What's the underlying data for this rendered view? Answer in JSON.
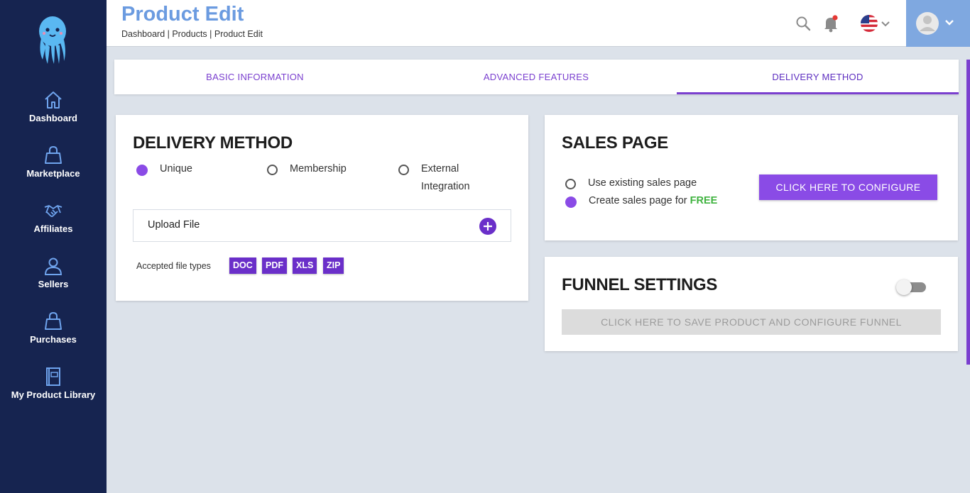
{
  "sidebar": {
    "items": [
      {
        "label": "Dashboard",
        "icon": "home-icon"
      },
      {
        "label": "Marketplace",
        "icon": "shopping-bag-icon"
      },
      {
        "label": "Affiliates",
        "icon": "handshake-icon"
      },
      {
        "label": "Sellers",
        "icon": "users-icon"
      },
      {
        "label": "Purchases",
        "icon": "shopping-bag-icon"
      },
      {
        "label": "My Product Library",
        "icon": "book-icon"
      }
    ]
  },
  "header": {
    "title": "Product Edit",
    "breadcrumb": "Dashboard | Products | Product Edit"
  },
  "tabs": [
    {
      "label": "BASIC INFORMATION",
      "active": false
    },
    {
      "label": "ADVANCED FEATURES",
      "active": false
    },
    {
      "label": "DELIVERY METHOD",
      "active": true
    }
  ],
  "delivery": {
    "title": "DELIVERY METHOD",
    "options": [
      {
        "label": "Unique",
        "checked": true
      },
      {
        "label": "Membership",
        "checked": false
      },
      {
        "label": "External Integration",
        "checked": false
      }
    ],
    "upload_label": "Upload File",
    "accepted_label": "Accepted file types",
    "file_types": [
      "DOC",
      "PDF",
      "XLS",
      "ZIP"
    ]
  },
  "sales": {
    "title": "SALES PAGE",
    "option_existing": "Use existing sales page",
    "option_create": "Create sales page for",
    "free_label": "FREE",
    "selected": "create",
    "configure_button": "CLICK HERE TO CONFIGURE"
  },
  "funnel": {
    "title": "FUNNEL SETTINGS",
    "enabled": false,
    "button": "CLICK HERE TO SAVE PRODUCT AND CONFIGURE FUNNEL"
  },
  "colors": {
    "sidebar": "#162450",
    "accent": "#7a3fcf",
    "title_blue": "#6b9be0",
    "free_green": "#3fb33f"
  }
}
